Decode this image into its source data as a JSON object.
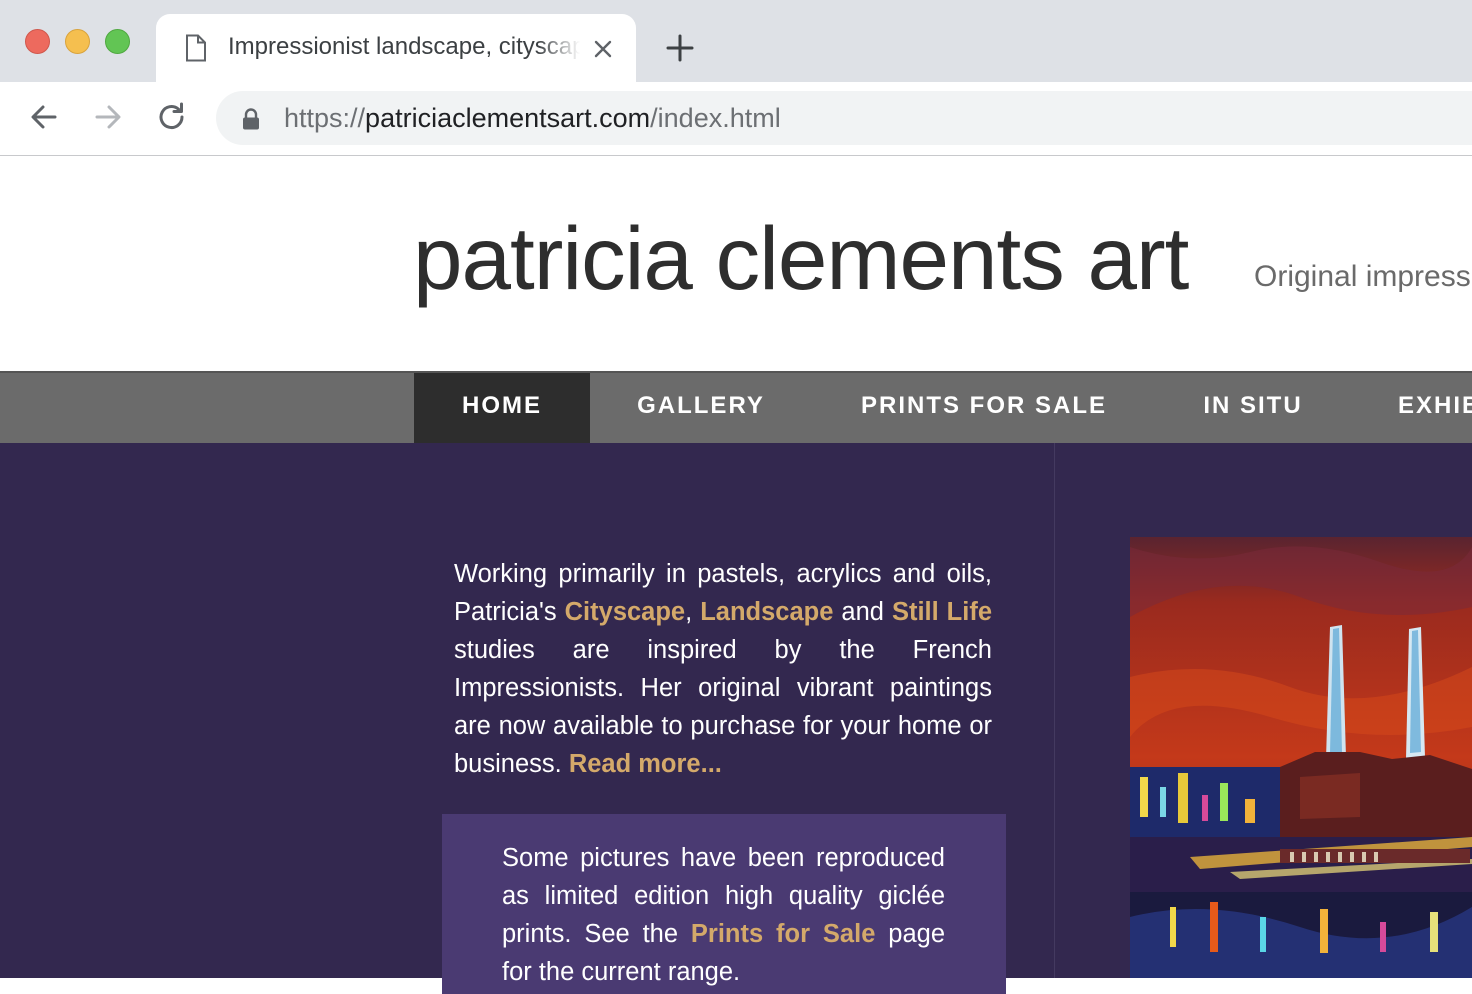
{
  "browser": {
    "tab_title": "Impressionist landscape, cityscape",
    "url_scheme": "https://",
    "url_host": "patriciaclementsart.com",
    "url_path": "/index.html"
  },
  "site": {
    "title": "patricia clements art",
    "tagline": "Original impress"
  },
  "nav": {
    "items": [
      {
        "label": "HOME"
      },
      {
        "label": "GALLERY"
      },
      {
        "label": "PRINTS FOR SALE"
      },
      {
        "label": "IN SITU"
      },
      {
        "label": "EXHIB"
      }
    ]
  },
  "intro": {
    "t1": "Working primarily in pastels, acrylics and oils, Patricia's ",
    "link_cityscape": "Cityscape",
    "t2": ", ",
    "link_landscape": "Landscape",
    "t3": " and ",
    "link_still_life": "Still Life",
    "t4": " studies are inspired by the French Impressionists. Her original vibrant paintings are now available to purchase for your home or business. ",
    "link_read_more": "Read more..."
  },
  "prints_box": {
    "t1": "Some pictures have been reproduced as limited edition high quality giclée prints. See the ",
    "link_prints": "Prints for Sale",
    "t2": " page for the current range."
  },
  "colors": {
    "content_bg": "#33284f",
    "box_bg": "#4a3a72",
    "link": "#d4a96a",
    "nav_bg": "#6b6b6b",
    "nav_active": "#2d2d2d"
  }
}
